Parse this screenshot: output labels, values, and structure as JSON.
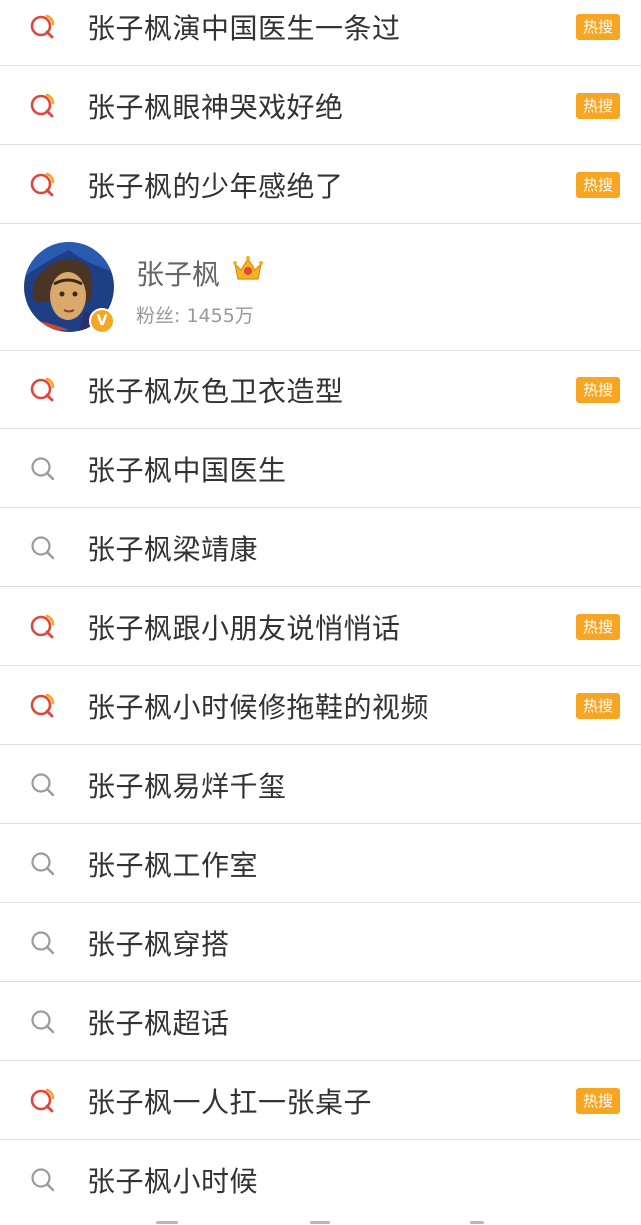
{
  "hot_badge": "热搜",
  "items_before": [
    {
      "text": "张子枫演中国医生一条过",
      "hot": true
    },
    {
      "text": "张子枫眼神哭戏好绝",
      "hot": true
    },
    {
      "text": "张子枫的少年感绝了",
      "hot": true
    }
  ],
  "user": {
    "name": "张子枫",
    "fans": "粉丝: 1455万",
    "verified_badge": "V"
  },
  "items_after": [
    {
      "text": "张子枫灰色卫衣造型",
      "hot": true
    },
    {
      "text": "张子枫中国医生",
      "hot": false
    },
    {
      "text": "张子枫梁靖康",
      "hot": false
    },
    {
      "text": "张子枫跟小朋友说悄悄话",
      "hot": true
    },
    {
      "text": "张子枫小时候修拖鞋的视频",
      "hot": true
    },
    {
      "text": "张子枫易烊千玺",
      "hot": false
    },
    {
      "text": "张子枫工作室",
      "hot": false
    },
    {
      "text": "张子枫穿搭",
      "hot": false
    },
    {
      "text": "张子枫超话",
      "hot": false
    },
    {
      "text": "张子枫一人扛一张桌子",
      "hot": true
    },
    {
      "text": "张子枫小时候",
      "hot": false
    }
  ],
  "colors": {
    "hot_badge": "#f6a623",
    "hot_icon": "#e0463c",
    "plain_icon": "#9b9b9b"
  },
  "icons": {
    "hot_search": "hot-search-icon",
    "search": "search-icon",
    "crown": "crown-icon"
  }
}
